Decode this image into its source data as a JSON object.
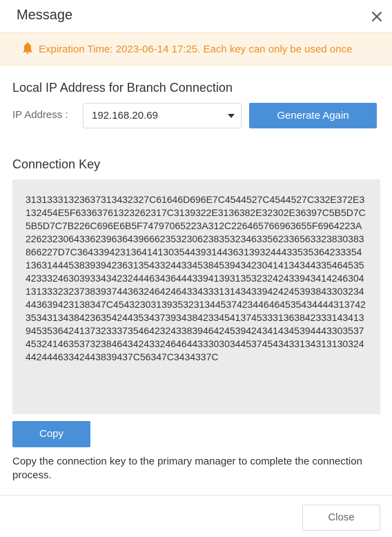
{
  "dialog": {
    "title": "Message",
    "close_icon": "close-icon"
  },
  "notice": {
    "icon": "bell-icon",
    "text": "Expiration Time: 2023-06-14 17:25. Each key can only be used once",
    "color": "#ef8d22",
    "background": "#fdf4e6"
  },
  "local_ip": {
    "section_title": "Local IP Address for Branch Connection",
    "label": "IP Address :",
    "selected_value": "192.168.20.69",
    "generate_label": "Generate Again"
  },
  "connection_key": {
    "section_title": "Connection Key",
    "key": "31313331323637313432327C61646D696E7C4544527C4544527C332E372E3132454E5F63363761323262317C3139322E3136382E32302E36397C5B5D7C5B5D7C7B226C696E6B5F74797065223A312C226465766963655F6964223A226232306433623963643966623532306238353234633562336563323830383866227D7C36433942313641413035443931443631393244433535364233354136314445383939423631354332443345384539434230414134344335464535423332463039334342324446343644433941393135323242433943414246304131333232373839374436324642464334333131434339424245393843303234443639423138347C4543230313935323134453742344646453543444431374235343134384236354244353437393438423345413745333136384233314341394535364241373233373546423243383946424539424341434539444330353745324146353732384643424332464644333030344537454343313431313032444244463342443839437C56347C3434337C",
    "copy_label": "Copy"
  },
  "hint": "Copy the connection key to the primary manager to complete the connection process.",
  "footer": {
    "close_label": "Close"
  },
  "colors": {
    "accent": "#4a90d9"
  }
}
